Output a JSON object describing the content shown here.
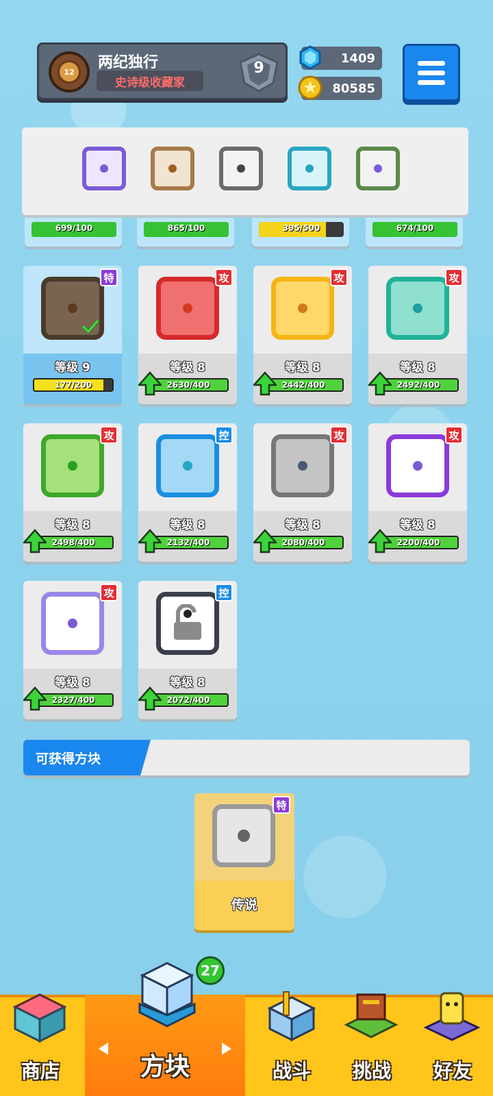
{
  "profile": {
    "name": "两纪独行",
    "title": "史诗级收藏家",
    "avatar_level": "12",
    "rank": "9"
  },
  "currency": {
    "gems": "1409",
    "coins": "80585"
  },
  "deck": [
    {
      "color": "#7b5bd6",
      "pip": "#7b5bd6"
    },
    {
      "color": "#a87a4a",
      "pip": "#a0601e"
    },
    {
      "color": "#8a8a8a",
      "pip": "#444444"
    },
    {
      "color": "#2aa6c2",
      "pip": "#2aa6c2"
    },
    {
      "color": "#3d6fd8",
      "pip": "#7b5bd6"
    }
  ],
  "partial_row": [
    {
      "progress": "699/100",
      "ratio": 1.0,
      "yellow": false
    },
    {
      "progress": "865/100",
      "ratio": 1.0,
      "yellow": false
    },
    {
      "progress": "395/500",
      "ratio": 0.79,
      "yellow": true
    },
    {
      "progress": "674/100",
      "ratio": 1.0,
      "yellow": false
    }
  ],
  "cards": [
    {
      "badge": "特",
      "badge_type": "spc",
      "level": "等级 9",
      "progress": "177/200",
      "ratio": 0.885,
      "yellow": true,
      "die_border": "#4a3a2c",
      "die_bg": "#7a6450",
      "pip": "#5a3a20",
      "selected": true
    },
    {
      "badge": "攻",
      "badge_type": "atk",
      "level": "等级 8",
      "progress": "2630/400",
      "ratio": 1.0,
      "yellow": false,
      "die_border": "#d62a2a",
      "die_bg": "#f07070",
      "pip": "#d63a1e"
    },
    {
      "badge": "攻",
      "badge_type": "atk",
      "level": "等级 8",
      "progress": "2442/400",
      "ratio": 1.0,
      "yellow": false,
      "die_border": "#f5b514",
      "die_bg": "#ffd86a",
      "pip": "#d07a18"
    },
    {
      "badge": "攻",
      "badge_type": "atk",
      "level": "等级 8",
      "progress": "2492/400",
      "ratio": 1.0,
      "yellow": false,
      "die_border": "#20b29a",
      "die_bg": "#8fe0cf",
      "pip": "#1ca0a0"
    },
    {
      "badge": "攻",
      "badge_type": "atk",
      "level": "等级 8",
      "progress": "2498/400",
      "ratio": 1.0,
      "yellow": false,
      "die_border": "#3ea82a",
      "die_bg": "#a6e07c",
      "pip": "#2aa020"
    },
    {
      "badge": "控",
      "badge_type": "ctl",
      "level": "等级 8",
      "progress": "2132/400",
      "ratio": 1.0,
      "yellow": false,
      "die_border": "#1a8ee0",
      "die_bg": "#a3d9f5",
      "pip": "#2aa6c2"
    },
    {
      "badge": "攻",
      "badge_type": "atk",
      "level": "等级 8",
      "progress": "2080/400",
      "ratio": 1.0,
      "yellow": false,
      "die_border": "#777777",
      "die_bg": "#c4c4c4",
      "pip": "#4a5a7a"
    },
    {
      "badge": "攻",
      "badge_type": "atk",
      "level": "等级 8",
      "progress": "2200/400",
      "ratio": 1.0,
      "yellow": false,
      "die_border": "#8b3bd9",
      "die_bg": "#ffffff",
      "pip": "#7a5ad6"
    },
    {
      "badge": "攻",
      "badge_type": "atk",
      "level": "等级 8",
      "progress": "2327/400",
      "ratio": 1.0,
      "yellow": false,
      "die_border": "#9a86e8",
      "die_bg": "#ffffff",
      "pip": "#7b5bd6"
    },
    {
      "badge": "控",
      "badge_type": "ctl",
      "level": "等级 8",
      "progress": "2072/400",
      "ratio": 1.0,
      "yellow": false,
      "die_border": "#3a3f4a",
      "die_bg": "#ffffff",
      "pip": "#222222",
      "lock": true
    }
  ],
  "available": {
    "title": "可获得方块",
    "legend_badge": "特",
    "legend_label": "传说"
  },
  "nav": {
    "count": "27",
    "items": [
      {
        "label": "商店",
        "icon": "shop-icon"
      },
      {
        "label": "方块",
        "icon": "dice-box-icon"
      },
      {
        "label": "战斗",
        "icon": "battle-icon"
      },
      {
        "label": "挑战",
        "icon": "challenge-icon"
      },
      {
        "label": "好友",
        "icon": "friends-icon"
      }
    ]
  }
}
